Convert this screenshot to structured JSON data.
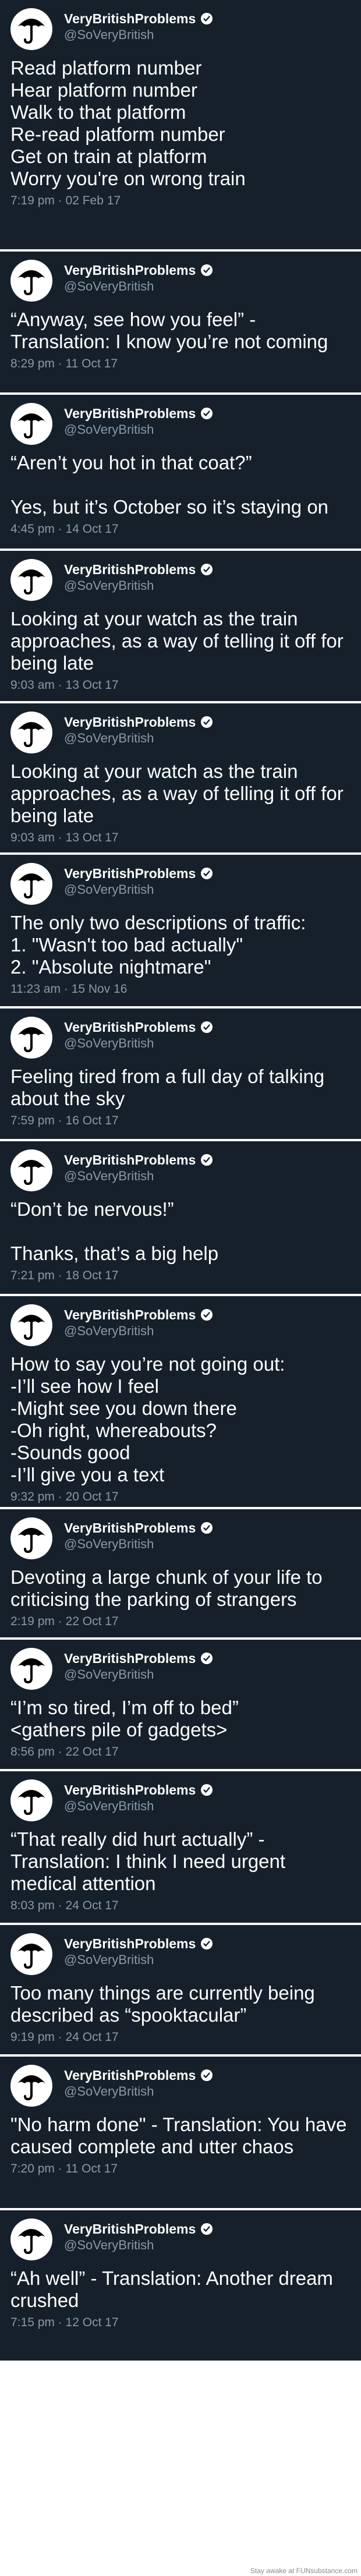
{
  "account": {
    "display_name": "VeryBritishProblems",
    "handle": "@SoVeryBritish",
    "verified_icon": "verified-badge-icon",
    "avatar_icon": "umbrella-icon"
  },
  "colors": {
    "tweet_background": "#15202b",
    "text": "#ffffff",
    "secondary_text": "#8899a6",
    "separator": "#ffffff"
  },
  "tweets": [
    {
      "text": "Read platform number\nHear platform number\nWalk to that platform\nRe-read platform number\nGet on train at platform\nWorry you're on wrong train",
      "timestamp": "7:19 pm · 02 Feb 17"
    },
    {
      "text": "“Anyway, see how you feel” - Translation: I know you’re not coming",
      "timestamp": "8:29 pm · 11 Oct 17"
    },
    {
      "text": "“Aren’t you hot in that coat?”\n\nYes, but it’s October so it’s staying on",
      "timestamp": "4:45 pm · 14 Oct 17"
    },
    {
      "text": "Looking at your watch as the train approaches, as a way of telling it off for being late",
      "timestamp": "9:03 am · 13 Oct 17"
    },
    {
      "text": "Looking at your watch as the train approaches, as a way of telling it off for being late",
      "timestamp": "9:03 am · 13 Oct 17"
    },
    {
      "text": "The only two descriptions of traffic:\n1. \"Wasn't too bad actually\"\n2. \"Absolute nightmare\"",
      "timestamp": "11:23 am · 15 Nov 16"
    },
    {
      "text": "Feeling tired from a full day of talking about the sky",
      "timestamp": "7:59 pm · 16 Oct 17"
    },
    {
      "text": "“Don’t be nervous!”\n\nThanks, that’s a big help",
      "timestamp": "7:21 pm · 18 Oct 17"
    },
    {
      "text": "How to say you’re not going out:\n-I’ll see how I feel\n-Might see you down there\n-Oh right, whereabouts?\n-Sounds good\n-I’ll give you a text",
      "timestamp": "9:32 pm · 20 Oct 17"
    },
    {
      "text": "Devoting a large chunk of your life to criticising the parking of strangers",
      "timestamp": "2:19 pm · 22 Oct 17"
    },
    {
      "text": "“I’m so tired, I’m off to bed”\n<gathers pile of gadgets>",
      "timestamp": "8:56 pm · 22 Oct 17"
    },
    {
      "text": "“That really did hurt actually” - Translation: I think I need urgent medical attention",
      "timestamp": "8:03 pm · 24 Oct 17"
    },
    {
      "text": "Too many things are currently being described as “spooktacular”",
      "timestamp": "9:19 pm · 24 Oct 17"
    },
    {
      "text": "\"No harm done\" - Translation: You have caused complete and utter chaos",
      "timestamp": "7:20 pm · 11 Oct 17"
    },
    {
      "text": "“Ah well” - Translation: Another dream crushed",
      "timestamp": "7:15 pm · 12 Oct 17"
    }
  ],
  "footer": {
    "credit": "Stay awake at FUNsubstance.com"
  }
}
